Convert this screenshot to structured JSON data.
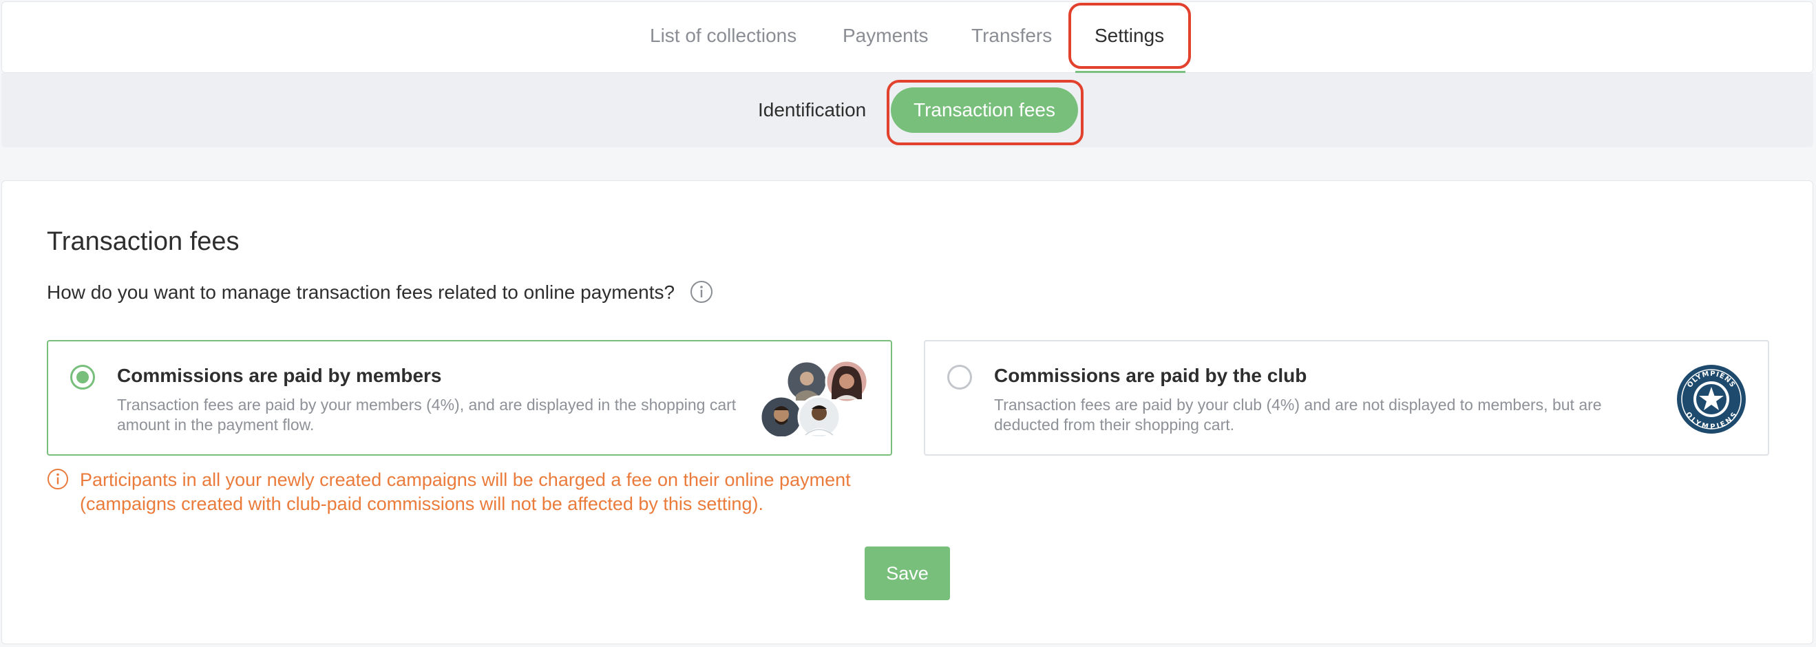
{
  "topnav": {
    "tabs": [
      {
        "label": "List of collections"
      },
      {
        "label": "Payments"
      },
      {
        "label": "Transfers"
      },
      {
        "label": "Settings"
      }
    ]
  },
  "subnav": {
    "tabs": [
      {
        "label": "Identification"
      },
      {
        "label": "Transaction fees"
      }
    ]
  },
  "section": {
    "title": "Transaction fees",
    "question": "How do you want to manage transaction fees related to online payments?"
  },
  "options": [
    {
      "title": "Commissions are paid by members",
      "description": "Transaction fees are paid by your members (4%), and are displayed in the shopping cart amount in the payment flow.",
      "selected": true
    },
    {
      "title": "Commissions are paid by the club",
      "description": "Transaction fees are paid by your club (4%) and are not displayed to members, but are deducted from their shopping cart.",
      "selected": false
    }
  ],
  "logo": {
    "ring_text": "OLYMPIENS"
  },
  "warning": "Participants in all your newly created campaigns will be charged a fee on their online payment (campaigns created with club-paid commissions will not be affected by this setting).",
  "save_label": "Save",
  "colors": {
    "accent": "#77bf7b",
    "warning": "#ea7b3b",
    "highlight": "#e1412d",
    "club_navy": "#1e4a6e"
  }
}
